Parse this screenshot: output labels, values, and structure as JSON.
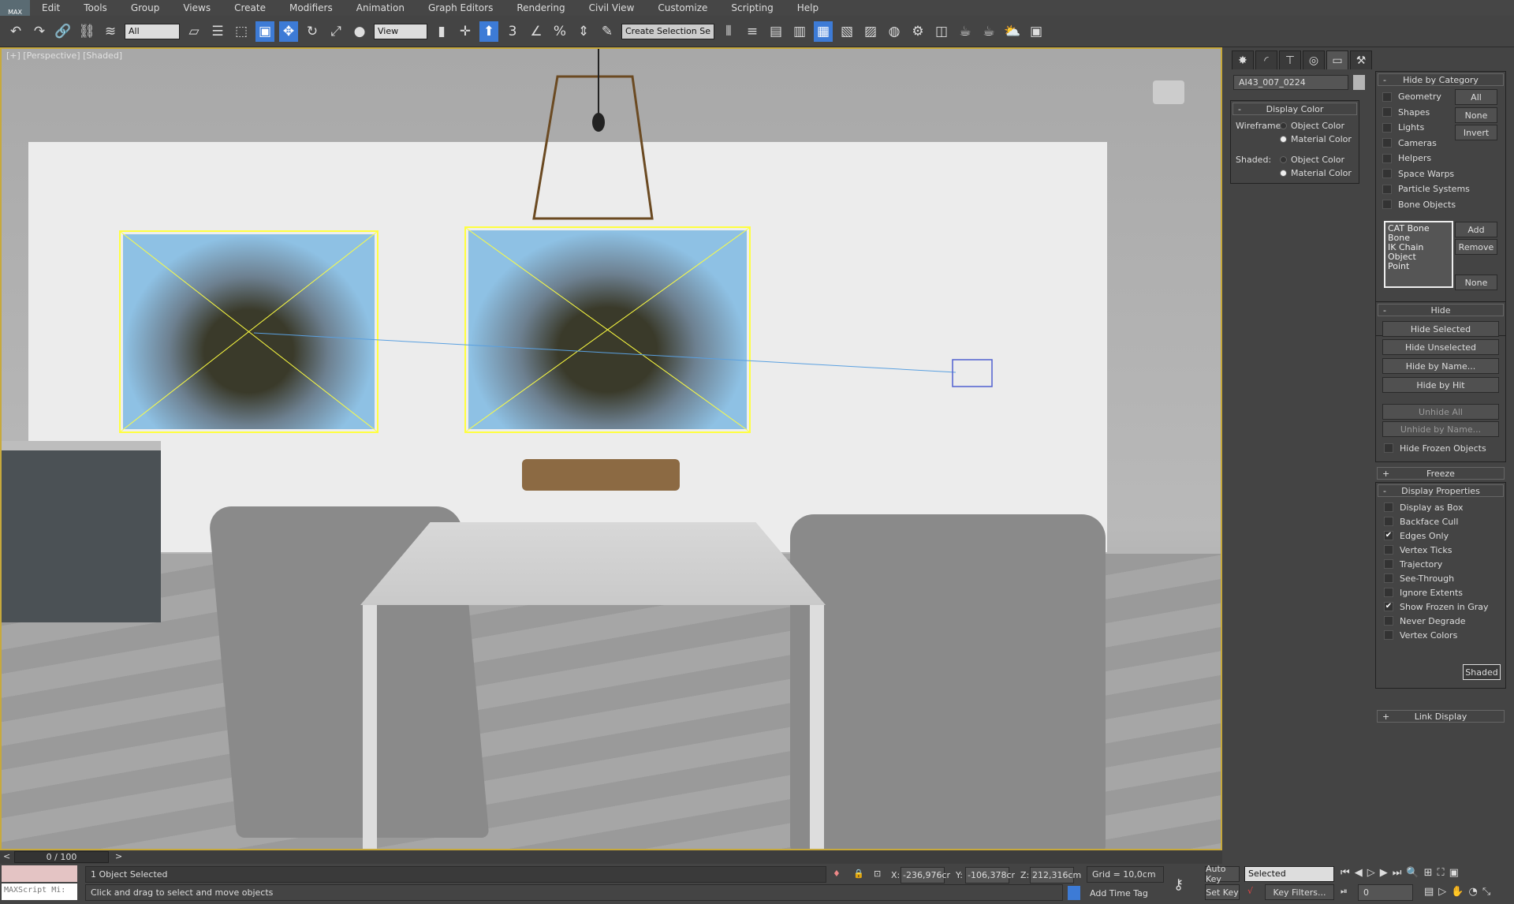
{
  "menubar": {
    "logo": "MAX",
    "items": [
      "Edit",
      "Tools",
      "Group",
      "Views",
      "Create",
      "Modifiers",
      "Animation",
      "Graph Editors",
      "Rendering",
      "Civil View",
      "Customize",
      "Scripting",
      "Help"
    ]
  },
  "toolbar": {
    "selection_filter": "All",
    "reference_coord": "View",
    "named_selection": "Create Selection Se",
    "snap_angle_label": "3"
  },
  "viewport": {
    "label": "[+] [Perspective] [Shaded]"
  },
  "panel": {
    "object_name": "AI43_007_0224",
    "display_color": {
      "title": "Display Color",
      "wireframe_label": "Wireframe:",
      "shaded_label": "Shaded:",
      "object_color": "Object Color",
      "material_color": "Material Color"
    },
    "hide_by_category": {
      "title": "Hide by Category",
      "items": [
        "Geometry",
        "Shapes",
        "Lights",
        "Cameras",
        "Helpers",
        "Space Warps",
        "Particle Systems",
        "Bone Objects"
      ],
      "buttons": [
        "All",
        "None",
        "Invert"
      ],
      "list": [
        "CAT Bone",
        "Bone",
        "IK Chain Object",
        "Point"
      ],
      "add": "Add",
      "remove": "Remove",
      "none": "None"
    },
    "hide": {
      "title": "Hide",
      "buttons": [
        "Hide Selected",
        "Hide Unselected",
        "Hide by Name...",
        "Hide by Hit"
      ],
      "unhide_all": "Unhide All",
      "unhide_by_name": "Unhide by Name...",
      "hide_frozen": "Hide Frozen Objects"
    },
    "freeze": {
      "title": "Freeze"
    },
    "display_properties": {
      "title": "Display Properties",
      "items": [
        {
          "label": "Display as Box",
          "checked": false
        },
        {
          "label": "Backface Cull",
          "checked": false
        },
        {
          "label": "Edges Only",
          "checked": true
        },
        {
          "label": "Vertex Ticks",
          "checked": false
        },
        {
          "label": "Trajectory",
          "checked": false
        },
        {
          "label": "See-Through",
          "checked": false
        },
        {
          "label": "Ignore Extents",
          "checked": false
        },
        {
          "label": "Show Frozen in Gray",
          "checked": true
        },
        {
          "label": "Never Degrade",
          "checked": false
        },
        {
          "label": "Vertex Colors",
          "checked": false
        }
      ],
      "shaded_button": "Shaded"
    },
    "link_display": {
      "title": "Link Display"
    }
  },
  "timeline": {
    "frame": "0 / 100",
    "prev": "<",
    "next": ">"
  },
  "status": {
    "maxscript": "MAXScript Mi:",
    "selected": "1 Object Selected",
    "prompt": "Click and drag to select and move objects",
    "x_label": "X:",
    "x": "-236,976cr",
    "y_label": "Y:",
    "y": "-106,378cr",
    "z_label": "Z:",
    "z": "212,316cm",
    "grid": "Grid = 10,0cm",
    "add_time_tag": "Add Time Tag",
    "auto_key": "Auto Key",
    "set_key": "Set Key",
    "key_mode": "Selected",
    "key_filters": "Key Filters...",
    "frame": "0"
  }
}
